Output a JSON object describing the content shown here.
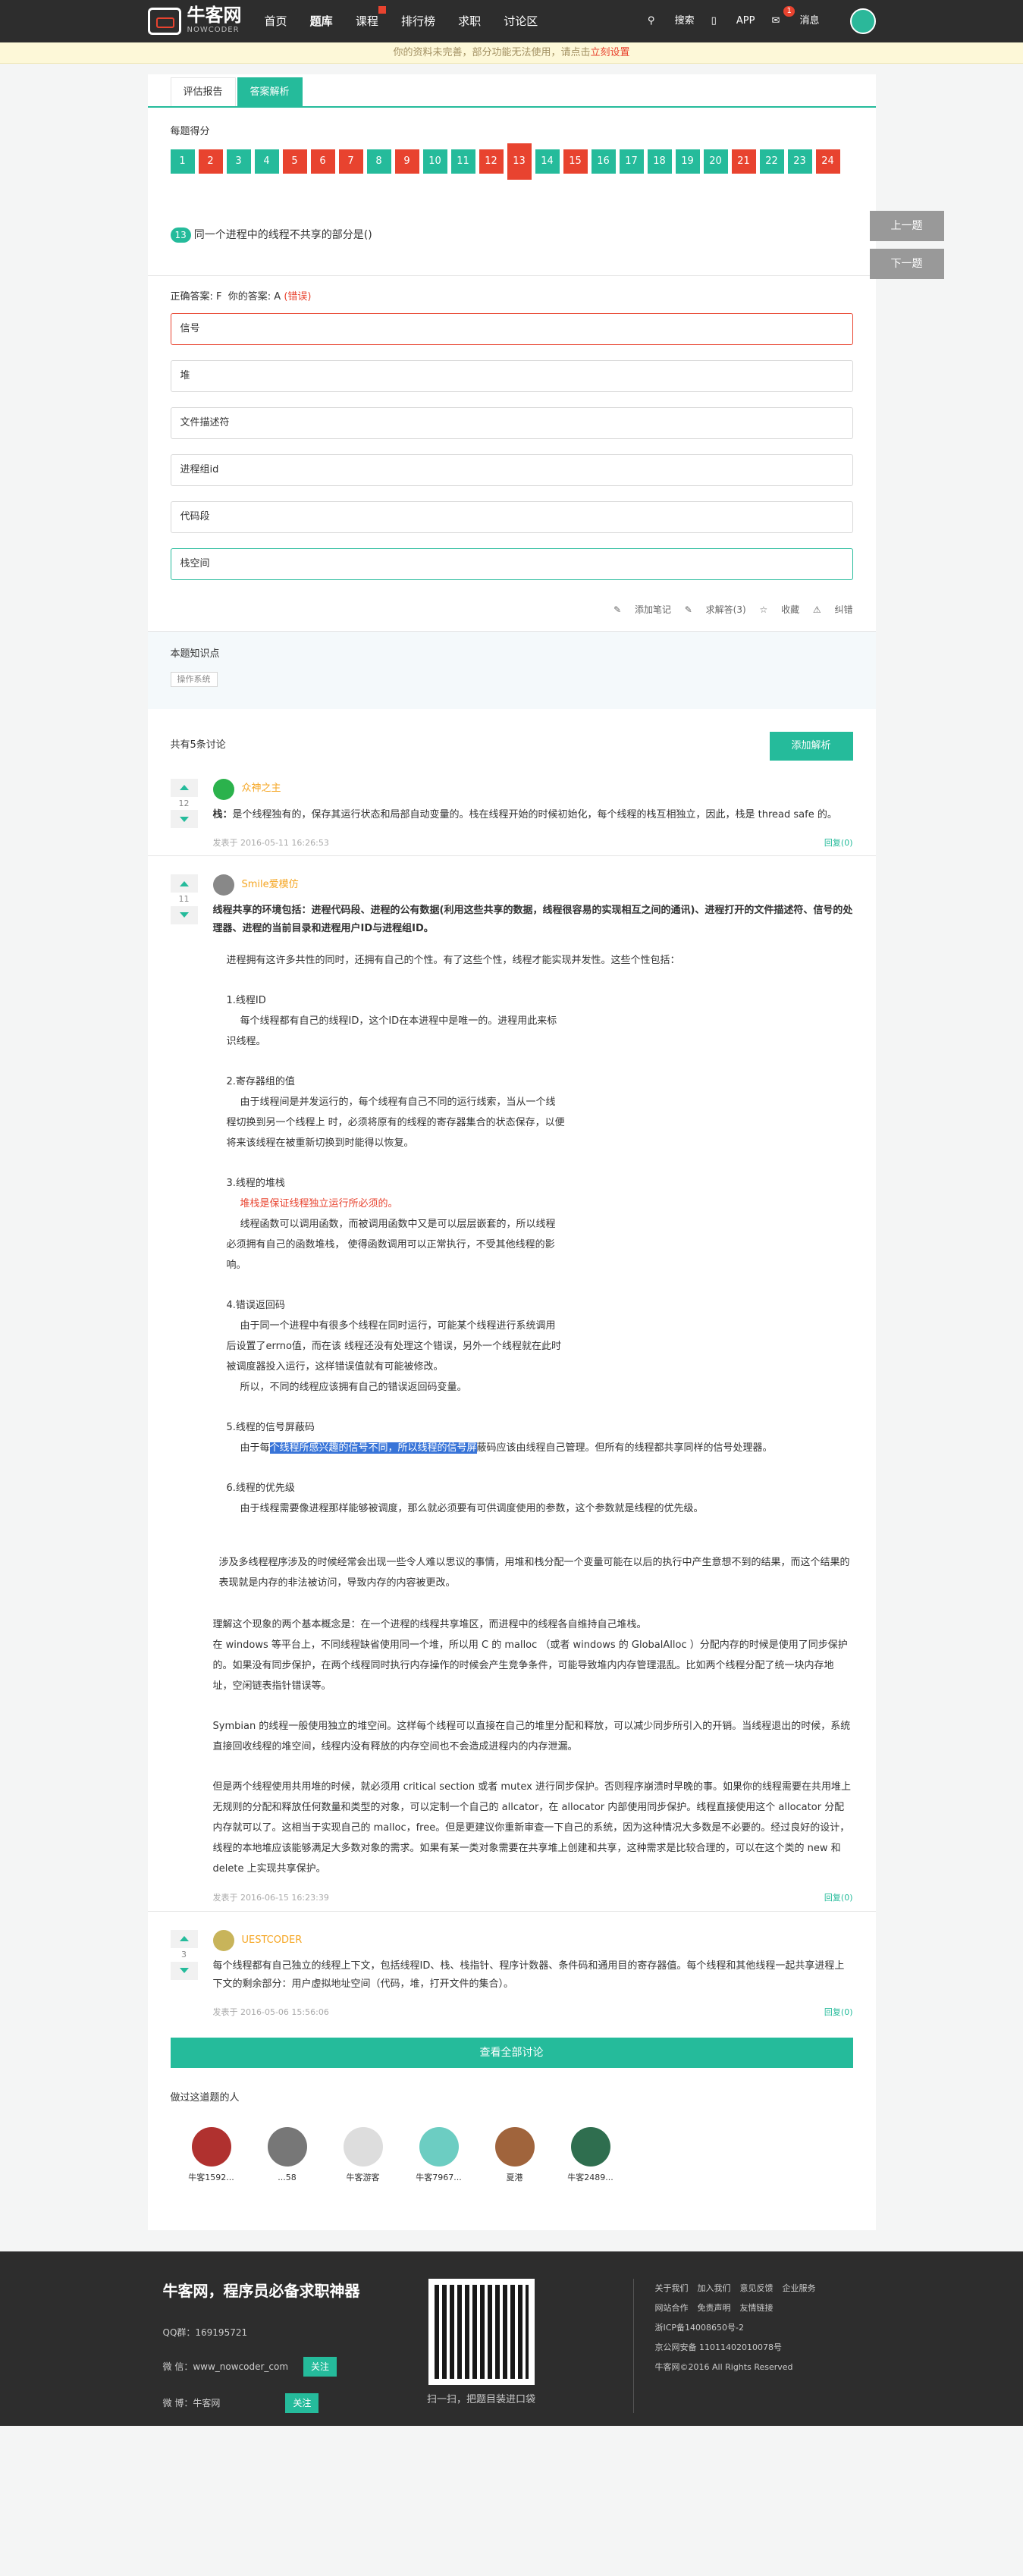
{
  "header": {
    "logo_text": "牛客网",
    "logo_sub": "NOWCODER",
    "nav": [
      "首页",
      "题库",
      "课程",
      "排行榜",
      "求职",
      "讨论区"
    ],
    "search": "搜索",
    "app": "APP",
    "msg": "消息",
    "msg_count": "1"
  },
  "notice": {
    "text": "你的资料未完善，部分功能无法使用，请点击",
    "link": "立刻设置"
  },
  "tabs": [
    "评估报告",
    "答案解析"
  ],
  "score_title": "每题得分",
  "qnums": [
    {
      "n": "1",
      "s": "g"
    },
    {
      "n": "2",
      "s": "r"
    },
    {
      "n": "3",
      "s": "g"
    },
    {
      "n": "4",
      "s": "g"
    },
    {
      "n": "5",
      "s": "r"
    },
    {
      "n": "6",
      "s": "r"
    },
    {
      "n": "7",
      "s": "r"
    },
    {
      "n": "8",
      "s": "g"
    },
    {
      "n": "9",
      "s": "r"
    },
    {
      "n": "10",
      "s": "g"
    },
    {
      "n": "11",
      "s": "g"
    },
    {
      "n": "12",
      "s": "r"
    },
    {
      "n": "13",
      "s": "r"
    },
    {
      "n": "14",
      "s": "g"
    },
    {
      "n": "15",
      "s": "r"
    },
    {
      "n": "16",
      "s": "g"
    },
    {
      "n": "17",
      "s": "g"
    },
    {
      "n": "18",
      "s": "g"
    },
    {
      "n": "19",
      "s": "g"
    },
    {
      "n": "20",
      "s": "g"
    },
    {
      "n": "21",
      "s": "r"
    },
    {
      "n": "22",
      "s": "g"
    },
    {
      "n": "23",
      "s": "g"
    },
    {
      "n": "24",
      "s": "r"
    }
  ],
  "pager": {
    "prev": "上一题",
    "next": "下一题"
  },
  "question": {
    "num": "13",
    "text": "同一个进程中的线程不共享的部分是()"
  },
  "answer": {
    "correct_label": "正确答案: F",
    "yours_label": "你的答案: A",
    "wrong": "(错误)"
  },
  "options": [
    "信号",
    "堆",
    "文件描述符",
    "进程组id",
    "代码段",
    "栈空间"
  ],
  "actions": [
    "添加笔记",
    "求解答(3)",
    "收藏",
    "纠错"
  ],
  "knowledge": {
    "title": "本题知识点",
    "tag": "操作系统"
  },
  "discuss": {
    "title": "共有5条讨论",
    "add": "添加解析"
  },
  "comments": {
    "c1": {
      "votes": "12",
      "name": "众神之主",
      "text_bold": "栈：",
      "text": "是个线程独有的，保存其运行状态和局部自动变量的。栈在线程开始的时候初始化，每个线程的栈互相独立，因此，栈是 thread safe 的。",
      "time": "发表于 2016-05-11 16:26:53",
      "reply": "回复(0)"
    },
    "c2": {
      "votes": "11",
      "name": "Smile爱模仿",
      "lead": "线程共享的环境包括：进程代码段、进程的公有数据(利用这些共享的数据，线程很容易的实现相互之间的通讯)、进程打开的文件描述符、信号的处理器、进程的当前目录和进程用户ID与进程组ID。",
      "intro": "进程拥有这许多共性的同时，还拥有自己的个性。有了这些个性，线程才能实现并发性。这些个性包括：",
      "p1_t": "1.线程ID",
      "p1_a": "每个线程都有自己的线程ID，这个ID在本进程中是唯一的。进程用此来标",
      "p1_b": "识线程。",
      "p2_t": "2.寄存器组的值",
      "p2_a": "由于线程间是并发运行的，每个线程有自己不同的运行线索，当从一个线",
      "p2_b": "程切换到另一个线程上 时，必须将原有的线程的寄存器集合的状态保存，以便",
      "p2_c": "将来该线程在被重新切换到时能得以恢复。",
      "p3_t": "3.线程的堆栈",
      "p3_r": "堆栈是保证线程独立运行所必须的。",
      "p3_a": "线程函数可以调用函数，而被调用函数中又是可以层层嵌套的，所以线程",
      "p3_b": "必须拥有自己的函数堆栈， 使得函数调用可以正常执行，不受其他线程的影",
      "p3_c": "响。",
      "p4_t": "4.错误返回码",
      "p4_a": "由于同一个进程中有很多个线程在同时运行，可能某个线程进行系统调用",
      "p4_b": "后设置了errno值，而在该 线程还没有处理这个错误，另外一个线程就在此时",
      "p4_c": "被调度器投入运行，这样错误值就有可能被修改。",
      "p4_d": "所以，不同的线程应该拥有自己的错误返回码变量。",
      "p5_t": "5.线程的信号屏蔽码",
      "p5_a": "由于每",
      "p5_hl": "个线程所感兴趣的信号不同，所以线程的信号屏",
      "p5_b": "蔽码应该由线程自己管理。但所有的线程都共享同样的信号处理器。",
      "p6_t": "6.线程的优先级",
      "p6_a": "由于线程需要像进程那样能够被调度，那么就必须要有可供调度使用的参数，这个参数就是线程的优先级。",
      "l1": "涉及多线程程序涉及的时候经常会出现一些令人难以思议的事情，用堆和栈分配一个变量可能在以后的执行中产生意想不到的结果，而这个结果的表现就是内存的非法被访问，导致内存的内容被更改。",
      "l2": "理解这个现象的两个基本概念是：在一个进程的线程共享堆区，而进程中的线程各自维持自己堆栈。",
      "l3": "在 windows 等平台上，不同线程缺省使用同一个堆，所以用 C 的 malloc （或者 windows 的 GlobalAlloc ）分配内存的时候是使用了同步保护的。如果没有同步保护，在两个线程同时执行内存操作的时候会产生竞争条件，可能导致堆内内存管理混乱。比如两个线程分配了统一块内存地址，空闲链表指针错误等。",
      "l4": "Symbian 的线程一般使用独立的堆空间。这样每个线程可以直接在自己的堆里分配和释放，可以减少同步所引入的开销。当线程退出的时候，系统直接回收线程的堆空间，线程内没有释放的内存空间也不会造成进程内的内存泄漏。",
      "l5": "但是两个线程使用共用堆的时候，就必须用 critical section 或者 mutex 进行同步保护。否则程序崩溃时早晚的事。如果你的线程需要在共用堆上无规则的分配和释放任何数量和类型的对象，可以定制一个自己的 allcator，在 allocator 内部使用同步保护。线程直接使用这个 allocator 分配内存就可以了。这相当于实现自己的 malloc，free。但是更建议你重新审查一下自己的系统，因为这种情况大多数是不必要的。经过良好的设计，线程的本地堆应该能够满足大多数对象的需求。如果有某一类对象需要在共享堆上创建和共享，这种需求是比较合理的，可以在这个类的 new 和 delete 上实现共享保护。",
      "time": "发表于 2016-06-15 16:23:39",
      "reply": "回复(0)"
    },
    "c3": {
      "votes": "3",
      "name": "UESTCODER",
      "text": "每个线程都有自己独立的线程上下文，包括线程ID、栈、栈指针、程序计数器、条件码和通用目的寄存器值。每个线程和其他线程一起共享进程上下文的剩余部分：用户虚拟地址空间（代码，堆，打开文件的集合）。",
      "time": "发表于 2016-05-06 15:56:06",
      "reply": "回复(0)"
    }
  },
  "view_all": "查看全部讨论",
  "peers": {
    "title": "做过这道题的人",
    "list": [
      "牛客1592...",
      "...58",
      "牛客游客",
      "牛客7967...",
      "夏港",
      "牛客2489..."
    ]
  },
  "footer": {
    "title": "牛客网，程序员必备求职神器",
    "qq": "QQ群：169195721",
    "wx": "微 信：www_nowcoder_com",
    "wb": "微 博：牛客网",
    "follow": "关注",
    "qr_text": "扫一扫，把题目装进口袋",
    "links": [
      "关于我们",
      "加入我们",
      "意见反馈",
      "企业服务",
      "网站合作",
      "免责声明",
      "友情链接"
    ],
    "icp": "浙ICP备14008650号-2",
    "police": "京公网安备 11011402010078号",
    "copyright": "牛客网©2016 All Rights Reserved"
  }
}
